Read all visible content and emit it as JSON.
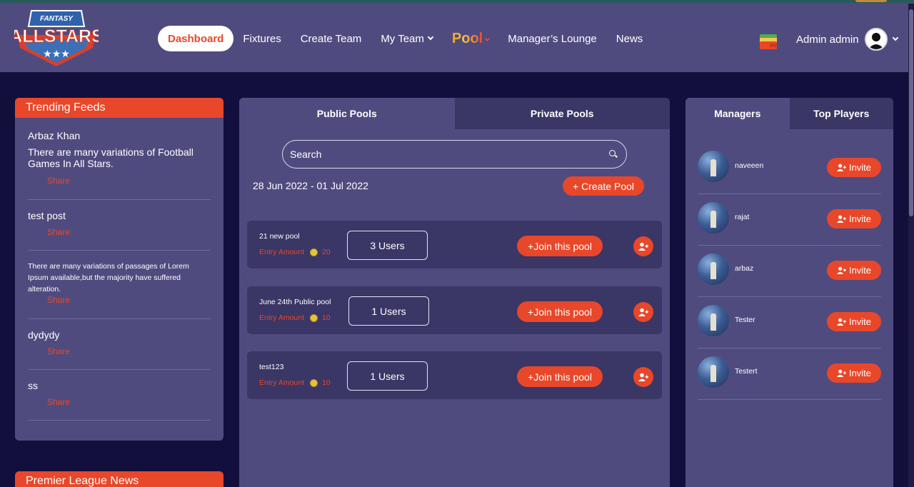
{
  "header": {
    "logo_top": "FANTASY",
    "logo_main": "ALLSTARS",
    "nav": [
      {
        "label": "Dashboard",
        "active": true
      },
      {
        "label": "Fixtures"
      },
      {
        "label": "Create Team"
      },
      {
        "label": "My Team",
        "dropdown": true
      },
      {
        "label": "Pool",
        "dropdown": true
      },
      {
        "label": "Manager’s Lounge"
      },
      {
        "label": "News"
      }
    ],
    "user_name": "Admin admin"
  },
  "trending": {
    "title": "Trending Feeds",
    "share_label": "Share",
    "feeds": [
      {
        "author": "Arbaz Khan",
        "text": "There are many variations of  Football Games In All Stars."
      },
      {
        "author": "test post",
        "text": ""
      },
      {
        "author": "",
        "text": "There are many variations of passages of Lorem Ipsum available,but the majority have suffered alteration."
      },
      {
        "author": "dydydy",
        "text": ""
      },
      {
        "author": "ss",
        "text": ""
      }
    ]
  },
  "premier_league": {
    "title": "Premier League News"
  },
  "pools": {
    "tabs": [
      "Public Pools",
      "Private Pools"
    ],
    "search_placeholder": "Search",
    "date_range": "28 Jun 2022 - 01 Jul 2022",
    "create_label": "+ Create Pool",
    "entry_label": "Entry Amount",
    "join_label": "+Join this pool",
    "items": [
      {
        "name": "21 new pool",
        "entry": "20",
        "users": "3 Users"
      },
      {
        "name": "June 24th Public pool",
        "entry": "10",
        "users": "1 Users"
      },
      {
        "name": "test123",
        "entry": "10",
        "users": "1 Users"
      }
    ]
  },
  "managers": {
    "tabs": [
      "Managers",
      "Top Players"
    ],
    "invite_label": "Invite",
    "items": [
      {
        "name": "naveeen"
      },
      {
        "name": "rajat"
      },
      {
        "name": "arbaz"
      },
      {
        "name": "Tester"
      },
      {
        "name": "Testert"
      }
    ]
  },
  "colors": {
    "accent": "#e8472a",
    "panel": "#504b7f",
    "background": "#130f3d",
    "card": "#3a3666"
  }
}
